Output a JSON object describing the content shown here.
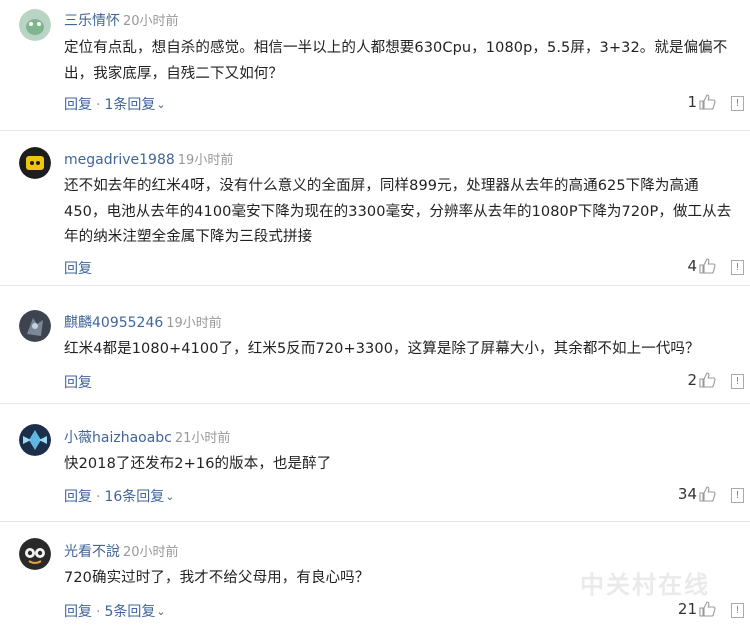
{
  "comments": [
    {
      "user": "三乐情怀",
      "time": "20小时前",
      "body": "定位有点乱，想自杀的感觉。相信一半以上的人都想要630Cpu，1080p，5.5屏，3+32。就是偏偏不出，我家底厚，自残二下又如何？",
      "reply_label": "回复",
      "replies_label": "1条回复",
      "likes": "1"
    },
    {
      "user": "megadrive1988",
      "time": "19小时前",
      "body": "还不如去年的红米4呀，没有什么意义的全面屏，同样899元，处理器从去年的高通625下降为高通450，电池从去年的4100毫安下降为现在的3300毫安，分辨率从去年的1080P下降为720P，做工从去年的纳米注塑全金属下降为三段式拼接",
      "reply_label": "回复",
      "replies_label": "",
      "likes": "4"
    },
    {
      "user": "麒麟40955246",
      "time": "19小时前",
      "body": "红米4都是1080+4100了，红米5反而720+3300，这算是除了屏幕大小，其余都不如上一代吗？",
      "reply_label": "回复",
      "replies_label": "",
      "likes": "2"
    },
    {
      "user": "小薇haizhaoabc",
      "time": "21小时前",
      "body": "快2018了还发布2+16的版本，也是醉了",
      "reply_label": "回复",
      "replies_label": "16条回复",
      "likes": "34"
    },
    {
      "user": "光看不說",
      "time": "20小时前",
      "body": "720确实过时了，我才不给父母用，有良心吗？",
      "reply_label": "回复",
      "replies_label": "5条回复",
      "likes": "21"
    }
  ],
  "icons": {
    "like": "thumbs-up-icon",
    "report": "report-icon",
    "chevron": "chevron-down-icon"
  },
  "report_glyph": "!",
  "chevron_glyph": "⌄",
  "separator": "·",
  "watermark": "中关村在线"
}
